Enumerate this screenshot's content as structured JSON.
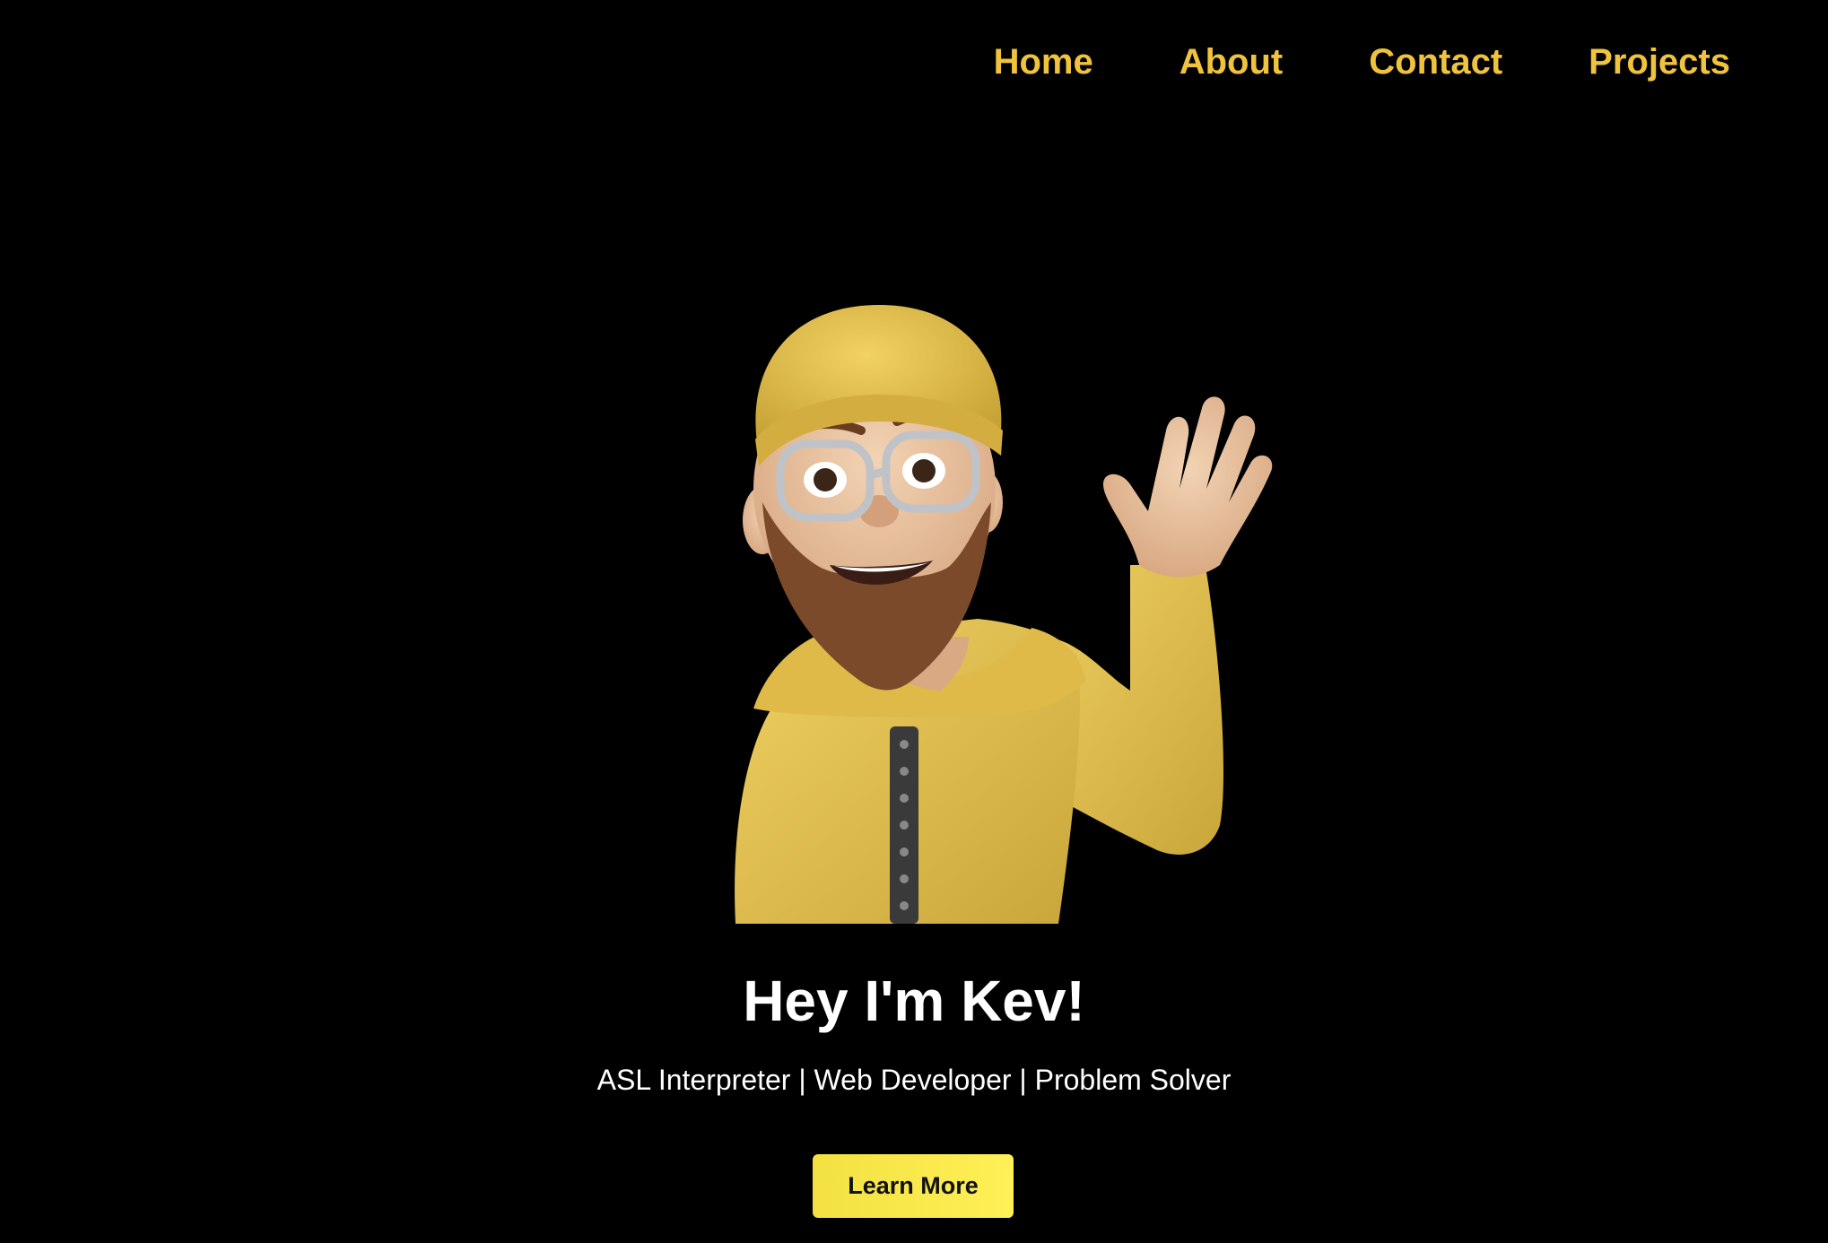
{
  "nav": {
    "items": [
      {
        "label": "Home"
      },
      {
        "label": "About"
      },
      {
        "label": "Contact"
      },
      {
        "label": "Projects"
      }
    ]
  },
  "hero": {
    "image": "memoji-waving-avatar",
    "title": "Hey I'm Kev!",
    "tagline": "ASL Interpreter | Web Developer | Problem Solver",
    "button_label": "Learn More"
  },
  "colors": {
    "background": "#000000",
    "accent": "#f0c33c",
    "button": "#f5e64a",
    "text": "#ffffff"
  }
}
